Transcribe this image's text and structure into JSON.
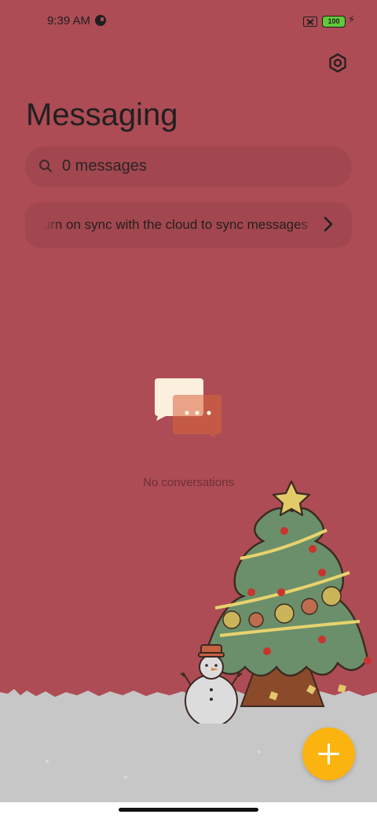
{
  "status_bar": {
    "time": "9:39 AM",
    "battery_level": "100",
    "icons": [
      "data-saver-icon",
      "no-sim-icon",
      "battery-icon",
      "charging-bolt-icon"
    ]
  },
  "header": {
    "title": "Messaging",
    "settings_icon": "settings-hexagon-icon"
  },
  "search": {
    "placeholder": "0 messages",
    "icon": "search-icon"
  },
  "sync_banner": {
    "text": "Turn on sync with the cloud to sync messages",
    "icon": "chevron-right-icon"
  },
  "empty_state": {
    "text": "No conversations",
    "icon": "chat-bubbles-icon"
  },
  "fab": {
    "icon": "plus-icon"
  },
  "colors": {
    "background": "#ad4c54",
    "search_bg": "#a2474f",
    "fab": "#fbb40f",
    "tree": "#6b8f6a",
    "snow": "#c7c7c7"
  }
}
